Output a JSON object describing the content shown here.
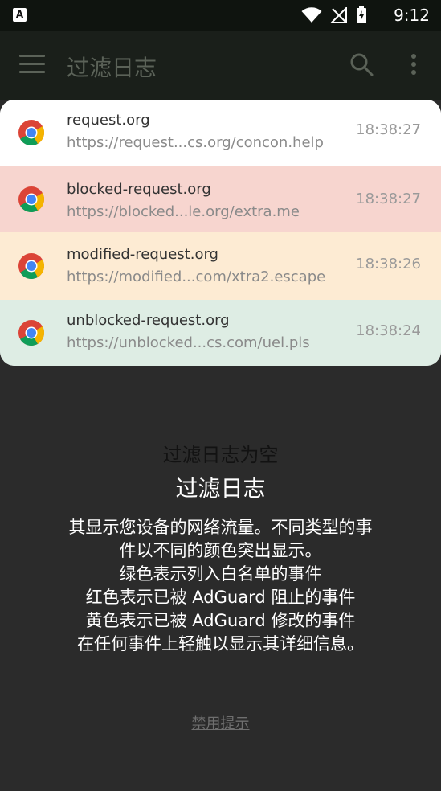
{
  "status_bar": {
    "left_badge": "A",
    "time": "9:12",
    "icons": [
      "wifi-icon",
      "no-signal-icon",
      "battery-charging-icon"
    ]
  },
  "app_bar": {
    "title": "过滤日志",
    "menu_icon": "menu-icon",
    "search_icon": "search-icon",
    "more_icon": "more-vert-icon"
  },
  "log_rows": [
    {
      "domain": "request.org",
      "url": "https://request...cs.org/concon.help",
      "time": "18:38:27",
      "color": "#ffffff"
    },
    {
      "domain": "blocked-request.org",
      "url": "https://blocked...le.org/extra.me",
      "time": "18:38:27",
      "color": "#f7d5cf"
    },
    {
      "domain": "modified-request.org",
      "url": "https://modified...com/xtra2.escape",
      "time": "18:38:26",
      "color": "#fdebd3"
    },
    {
      "domain": "unblocked-request.org",
      "url": "https://unblocked...cs.com/uel.pls",
      "time": "18:38:24",
      "color": "#deede4"
    }
  ],
  "empty_state": {
    "title": "过滤日志为空",
    "heading": "过滤日志",
    "description_lines": [
      "其显示您设备的网络流量。不同类型的事",
      "件以不同的颜色突出显示。",
      "绿色表示列入白名单的事件",
      "红色表示已被 AdGuard 阻止的事件",
      "黄色表示已被 AdGuard 修改的事件",
      "在任何事件上轻触以显示其详细信息。"
    ],
    "disable_hint": "禁用提示"
  }
}
